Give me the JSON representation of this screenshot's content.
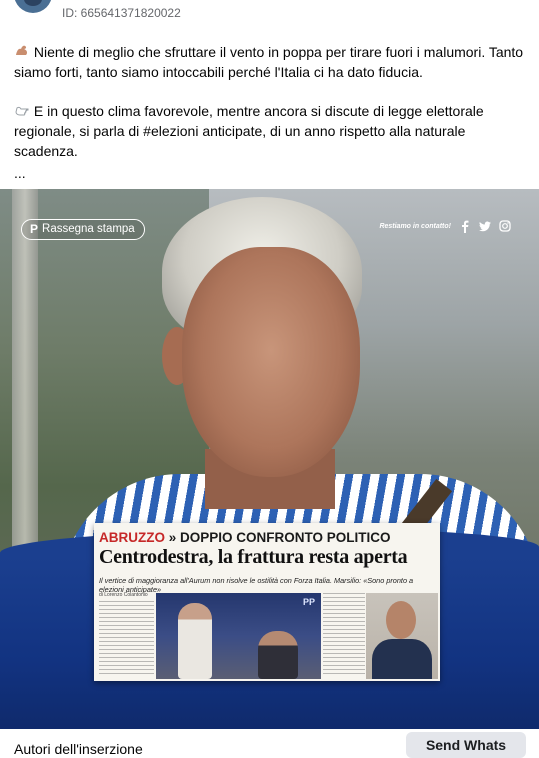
{
  "header": {
    "post_id": "ID: 665641371820022"
  },
  "post": {
    "paragraph_1": {
      "emoji": "muscle-emoji",
      "text": "Niente di meglio che sfruttare il vento in poppa per tirare fuori i malumori. Tanto siamo forti, tanto siamo intoccabili perché l'Italia ci ha dato fiducia."
    },
    "paragraph_2": {
      "emoji": "pointing-hand-emoji",
      "text": "E in questo clima favorevole, mentre ancora si discute di legge elettorale regionale, si parla di #elezioni anticipate, di un anno rispetto alla naturale scadenza."
    },
    "ellipsis": "..."
  },
  "media": {
    "badge_label": "Rassegna stampa",
    "social_text": "Restiamo in contatto!",
    "social_icons": [
      "facebook-icon",
      "twitter-icon",
      "instagram-icon"
    ],
    "clipping": {
      "kicker_region": "ABRUZZO",
      "kicker_separator": "»",
      "kicker_rest": "DOPPIO CONFRONTO POLITICO",
      "headline": "Centrodestra, la frattura resta aperta",
      "subheadline": "Il vertice di maggioranza all'Aurum non risolve le ostilità con Forza Italia. Marsilio: «Sono pronto a elezioni anticipate»",
      "byline": "di Lorenzo Colantonio",
      "photo_caption": "PP"
    },
    "colors": {
      "band_blue": "#1b3f8f",
      "kicker_red": "#c62828"
    }
  },
  "footer": {
    "left_text": "Autori dell'inserzione",
    "send_button_label": "Send Whats"
  }
}
